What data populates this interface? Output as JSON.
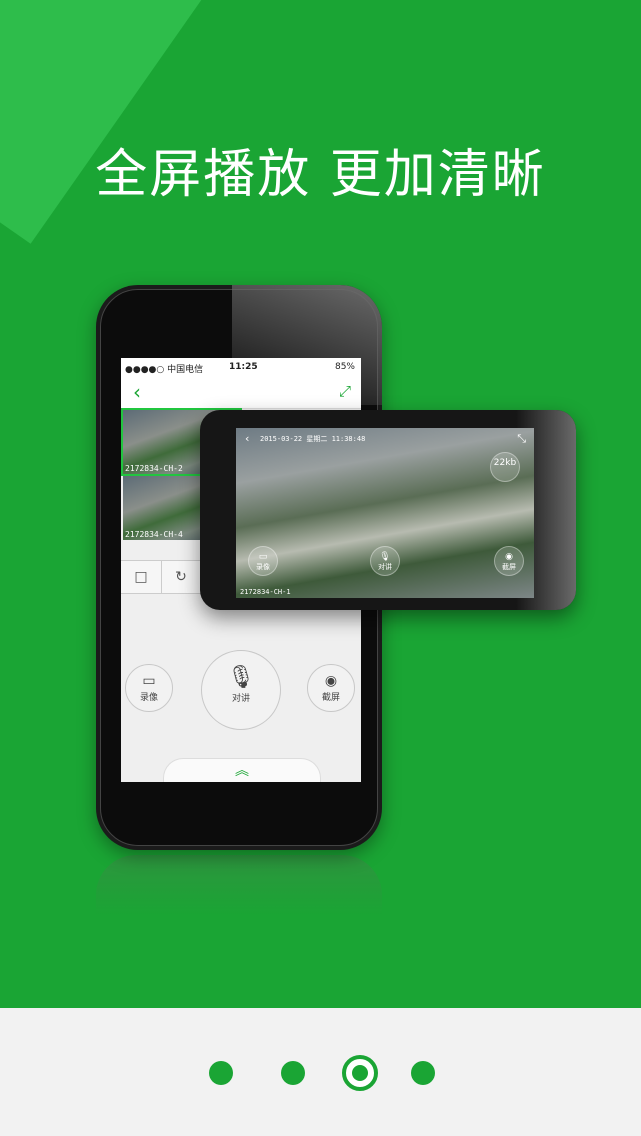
{
  "headline": "全屏播放  更加清晰",
  "phone": {
    "status": {
      "signal": "●●●●○ 中国电信",
      "time": "11:25",
      "battery": "85%"
    },
    "nav": {
      "back_icon": "‹",
      "expand_icon": "⤢"
    },
    "cameras": [
      {
        "label": "2172834-CH-2"
      },
      {
        "label": ""
      },
      {
        "label": "2172834-CH-4"
      },
      {
        "label": ""
      }
    ],
    "controls": {
      "record": "录像",
      "talk": "对讲",
      "screenshot": "截屏"
    },
    "pull_up_icon": "︽"
  },
  "landscape": {
    "timestamp": "2015-03-22 星期二 11:38:48",
    "camera_label": "2172834-CH-1",
    "speed": "22kb",
    "record": "录像",
    "talk": "对讲",
    "screenshot": "截屏",
    "collapse_icon": "⤡"
  },
  "pager": {
    "count": 4,
    "active_index": 2
  },
  "colors": {
    "brand_green": "#1aa534",
    "accent_light": "#2ebd4b",
    "bottom_bg": "#f2f2f2"
  }
}
